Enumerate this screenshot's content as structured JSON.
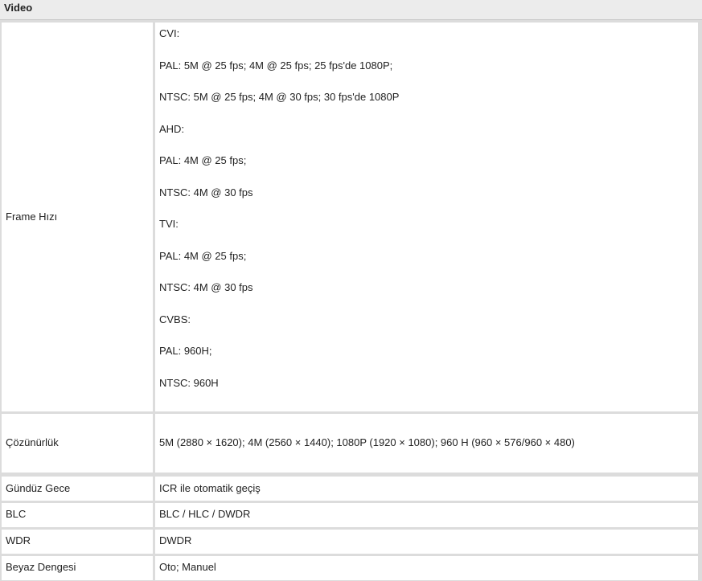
{
  "section_title": "Video",
  "rows": [
    {
      "label": "Frame Hızı",
      "values": [
        "CVI:",
        "PAL: 5M @ 25 fps; 4M @ 25 fps; 25 fps'de 1080P;",
        "NTSC: 5M @ 25 fps; 4M @ 30 fps; 30 fps'de 1080P",
        "AHD:",
        "PAL: 4M @ 25 fps;",
        "NTSC: 4M @ 30 fps",
        "TVI:",
        "PAL: 4M @ 25 fps;",
        "NTSC: 4M @ 30 fps",
        "CVBS:",
        "PAL: 960H;",
        "NTSC: 960H"
      ]
    },
    {
      "label": "Çözünürlük",
      "value": "5M (2880 × 1620); 4M (2560 × 1440); 1080P (1920 × 1080); 960 H (960 × 576/960 × 480)"
    },
    {
      "label": "Gündüz Gece",
      "value": "ICR ile otomatik geçiş"
    },
    {
      "label": "BLC",
      "value": "BLC / HLC / DWDR"
    },
    {
      "label": "WDR",
      "value": "DWDR"
    },
    {
      "label": "Beyaz Dengesi",
      "value": "Oto; Manuel"
    }
  ]
}
